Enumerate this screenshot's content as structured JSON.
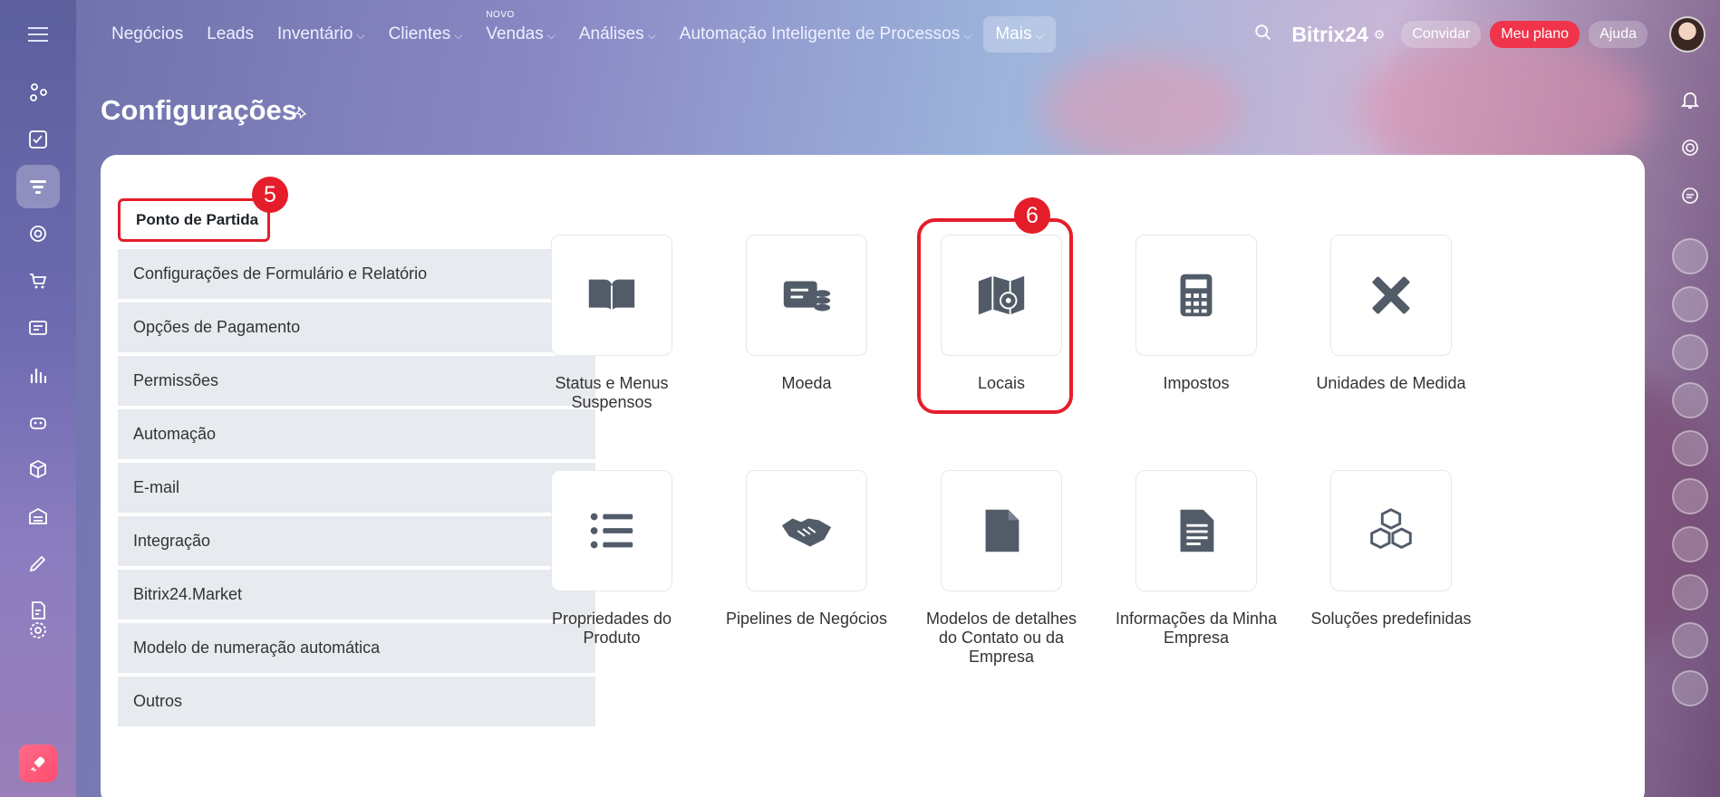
{
  "topbar": {
    "nav": [
      {
        "label": "Negócios",
        "chevron": false
      },
      {
        "label": "Leads",
        "chevron": false
      },
      {
        "label": "Inventário",
        "chevron": true
      },
      {
        "label": "Clientes",
        "chevron": true
      },
      {
        "label": "Vendas",
        "chevron": true,
        "badge": "NOVO"
      },
      {
        "label": "Análises",
        "chevron": true
      },
      {
        "label": "Automação Inteligente de Processos",
        "chevron": true
      },
      {
        "label": "Mais",
        "chevron": true,
        "active": true
      }
    ],
    "brand": "Bitrix24",
    "invite_label": "Convidar",
    "plan_label": "Meu plano",
    "help_label": "Ajuda"
  },
  "page": {
    "title": "Configurações"
  },
  "settings_menu": {
    "first": "Ponto de Partida",
    "items": [
      "Configurações de Formulário e Relatório",
      "Opções de Pagamento",
      "Permissões",
      "Automação",
      "E-mail",
      "Integração",
      "Bitrix24.Market",
      "Modelo de numeração automática",
      "Outros"
    ]
  },
  "annotations": {
    "step_menu": "5",
    "step_tile": "6"
  },
  "tiles": [
    {
      "label": "Status e Menus Suspensos",
      "icon": "book-icon"
    },
    {
      "label": "Moeda",
      "icon": "currency-icon"
    },
    {
      "label": "Locais",
      "icon": "map-pin-icon"
    },
    {
      "label": "Impostos",
      "icon": "calculator-icon"
    },
    {
      "label": "Unidades de Medida",
      "icon": "ruler-pencil-icon"
    },
    {
      "label": "Propriedades do Produto",
      "icon": "list-icon"
    },
    {
      "label": "Pipelines de Negócios",
      "icon": "handshake-icon"
    },
    {
      "label": "Modelos de detalhes do Contato ou da Empresa",
      "icon": "file-icon"
    },
    {
      "label": "Informações da Minha Empresa",
      "icon": "document-icon"
    },
    {
      "label": "Soluções predefinidas",
      "icon": "cubes-icon"
    }
  ],
  "colors": {
    "accent_red": "#e51d2a",
    "tile_icon": "#525c69",
    "menu_bg": "#e7eaee"
  }
}
